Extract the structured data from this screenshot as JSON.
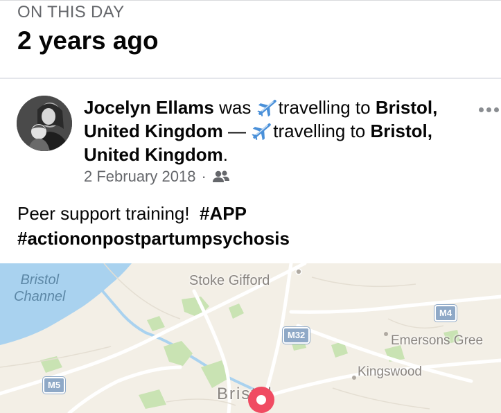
{
  "memory": {
    "section_label": "ON THIS DAY",
    "title": "2 years ago"
  },
  "post": {
    "author": "Jocelyn Ellams",
    "text_was": "was",
    "activity": "travelling to",
    "location": "Bristol, United Kingdom",
    "dash": "—",
    "period": ".",
    "date": "2 February 2018",
    "separator": "·",
    "audience_icon": "friends-icon",
    "body_text": "Peer support training!",
    "hashtag_1": "#APP",
    "hashtag_2": "#actiononpostpartumpsychosis"
  },
  "map": {
    "water_label_line1": "Bristol",
    "water_label_line2": "Channel",
    "places": {
      "stoke_gifford": "Stoke Gifford",
      "emersons_green": "Emersons Gree",
      "kingswood": "Kingswood",
      "bristol": "Bristol"
    },
    "roads": {
      "m4": "M4",
      "m32": "M32",
      "m5": "M5"
    },
    "colors": {
      "land": "#f3efe6",
      "water": "#a9d2ef",
      "park": "#c9e3b3",
      "pin": "#f04b62"
    }
  }
}
